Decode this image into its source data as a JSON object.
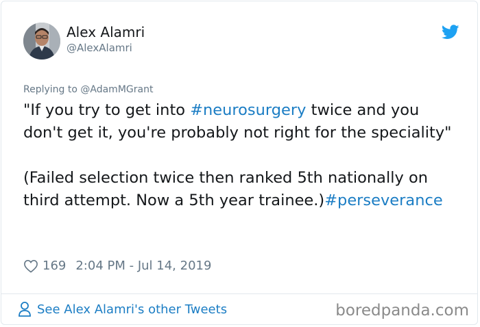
{
  "author": {
    "display_name": "Alex Alamri",
    "handle": "@AlexAlamri"
  },
  "reply_to": "Replying to @AdamMGrant",
  "tweet": {
    "line1_pre": "\"If you try to get into ",
    "hashtag1": "#neurosurgery",
    "line1_post": " twice and you don't get it, you're probably not right for the speciality\"",
    "para2": "(Failed selection twice then ranked 5th nationally on third attempt. Now a 5th year trainee.)",
    "hashtag2": "#perseverance"
  },
  "meta": {
    "likes": "169",
    "timestamp": "2:04 PM - Jul 14, 2019"
  },
  "footer": {
    "see_more": "See Alex Alamri's other Tweets",
    "watermark": "boredpanda.com"
  },
  "icons": {
    "bird": "twitter-bird-icon",
    "heart": "heart-icon",
    "person": "person-icon"
  },
  "colors": {
    "link": "#1b7dc4",
    "twitter_blue": "#1da1f2",
    "muted": "#657786"
  }
}
